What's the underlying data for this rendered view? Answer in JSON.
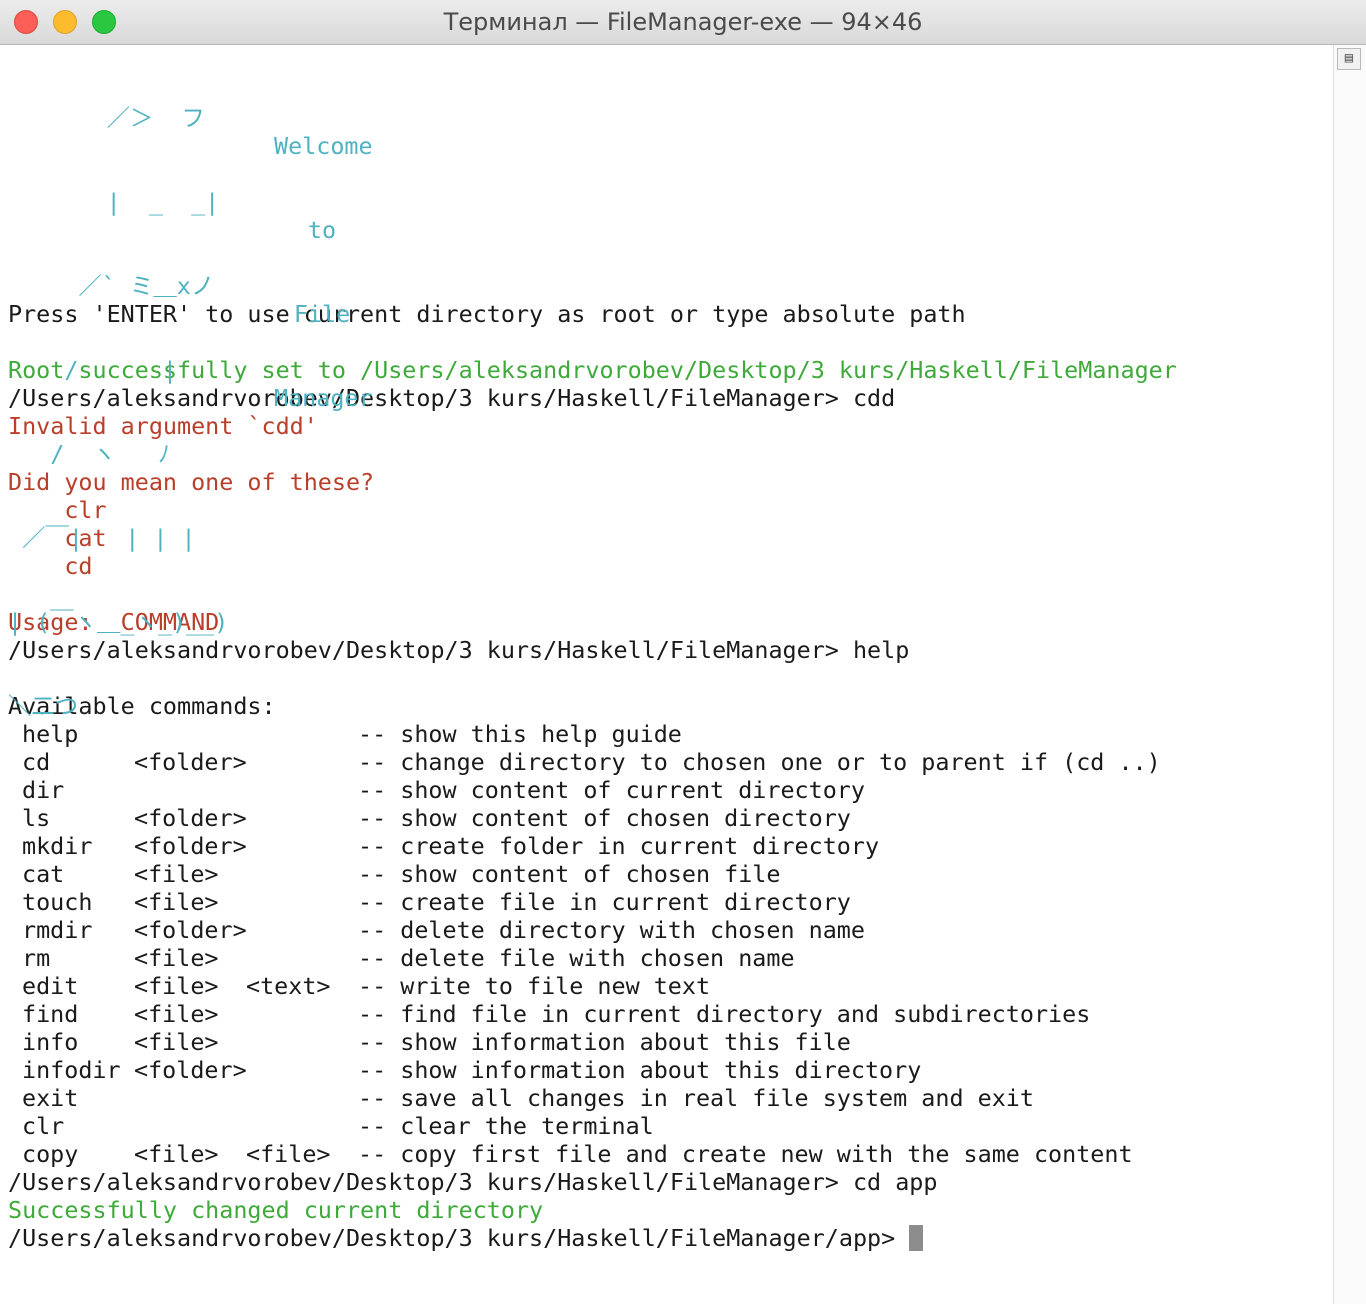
{
  "window": {
    "title": "Терминал — FileManager-exe — 94×46"
  },
  "art": {
    "left_lines": [
      "       ／＞  フ",
      "       |  _  _|",
      "     ／` ミ＿xノ",
      "    /      |",
      "   /  ヽ   ﾉ",
      " ／￣|   | | |",
      "| (￣ヽ＿_ヽ_)__)",
      "＼二つ"
    ],
    "right_lines": [
      "Welcome",
      "to",
      "File",
      "Manager"
    ]
  },
  "prompt_text": "Press 'ENTER' to use current directory as root or type absolute path",
  "root_msg": "Root successfully set to /Users/aleksandrvorobev/Desktop/3 kurs/Haskell/FileManager",
  "prompt1": "/Users/aleksandrvorobev/Desktop/3 kurs/Haskell/FileManager> cdd",
  "invalid_arg": "Invalid argument `cdd'",
  "suggest_title": "Did you mean one of these?",
  "suggestions": [
    "    clr",
    "    cat",
    "    cd"
  ],
  "usage": "Usage:  COMMAND",
  "prompt2": "/Users/aleksandrvorobev/Desktop/3 kurs/Haskell/FileManager> help",
  "available": "Available commands:",
  "commands": [
    {
      "name": "help",
      "arg1": "",
      "arg2": "",
      "desc": "-- show this help guide"
    },
    {
      "name": "cd",
      "arg1": "<folder>",
      "arg2": "",
      "desc": "-- change directory to chosen one or to parent if (cd ..)"
    },
    {
      "name": "dir",
      "arg1": "",
      "arg2": "",
      "desc": "-- show content of current directory"
    },
    {
      "name": "ls",
      "arg1": "<folder>",
      "arg2": "",
      "desc": "-- show content of chosen directory"
    },
    {
      "name": "mkdir",
      "arg1": "<folder>",
      "arg2": "",
      "desc": "-- create folder in current directory"
    },
    {
      "name": "cat",
      "arg1": "<file>",
      "arg2": "",
      "desc": "-- show content of chosen file"
    },
    {
      "name": "touch",
      "arg1": "<file>",
      "arg2": "",
      "desc": "-- create file in current directory"
    },
    {
      "name": "rmdir",
      "arg1": "<folder>",
      "arg2": "",
      "desc": "-- delete directory with chosen name"
    },
    {
      "name": "rm",
      "arg1": "<file>",
      "arg2": "",
      "desc": "-- delete file with chosen name"
    },
    {
      "name": "edit",
      "arg1": "<file>",
      "arg2": "<text>",
      "desc": "-- write to file new text"
    },
    {
      "name": "find",
      "arg1": "<file>",
      "arg2": "",
      "desc": "-- find file in current directory and subdirectories"
    },
    {
      "name": "info",
      "arg1": "<file>",
      "arg2": "",
      "desc": "-- show information about this file"
    },
    {
      "name": "infodir",
      "arg1": "<folder>",
      "arg2": "",
      "desc": "-- show information about this directory"
    },
    {
      "name": "exit",
      "arg1": "",
      "arg2": "",
      "desc": "-- save all changes in real file system and exit"
    },
    {
      "name": "clr",
      "arg1": "",
      "arg2": "",
      "desc": "-- clear the terminal"
    },
    {
      "name": "copy",
      "arg1": "<file>",
      "arg2": "<file>",
      "desc": "-- copy first file and create new with the same content"
    }
  ],
  "prompt3": "/Users/aleksandrvorobev/Desktop/3 kurs/Haskell/FileManager> cd app",
  "success_msg": "Successfully changed current directory",
  "prompt4": "/Users/aleksandrvorobev/Desktop/3 kurs/Haskell/FileManager/app>",
  "colors": {
    "accent_cyan": "#4fb2c1",
    "success_green": "#3eaa3a",
    "error_red": "#b93f2a"
  }
}
